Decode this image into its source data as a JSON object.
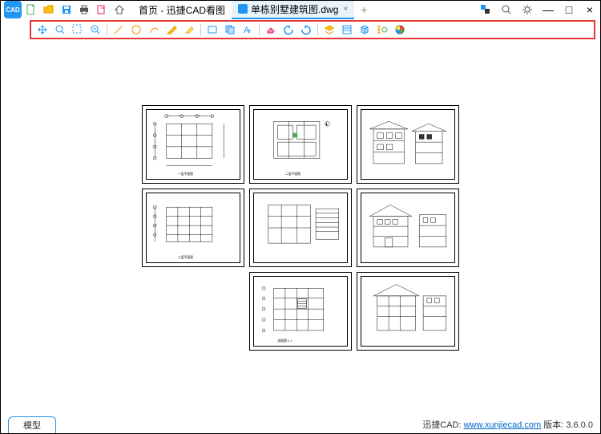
{
  "app": {
    "icon_text": "CAD"
  },
  "tabs": {
    "home_label": "首页 - 迅捷CAD看图",
    "file_label": "单栋别墅建筑图.dwg",
    "close": "×",
    "add": "+"
  },
  "bottom": {
    "model": "模型"
  },
  "footer": {
    "prefix": "迅捷CAD: ",
    "link": "www.xunjiecad.com",
    "version_label": " 版本: ",
    "version": "3.6.0.0"
  }
}
